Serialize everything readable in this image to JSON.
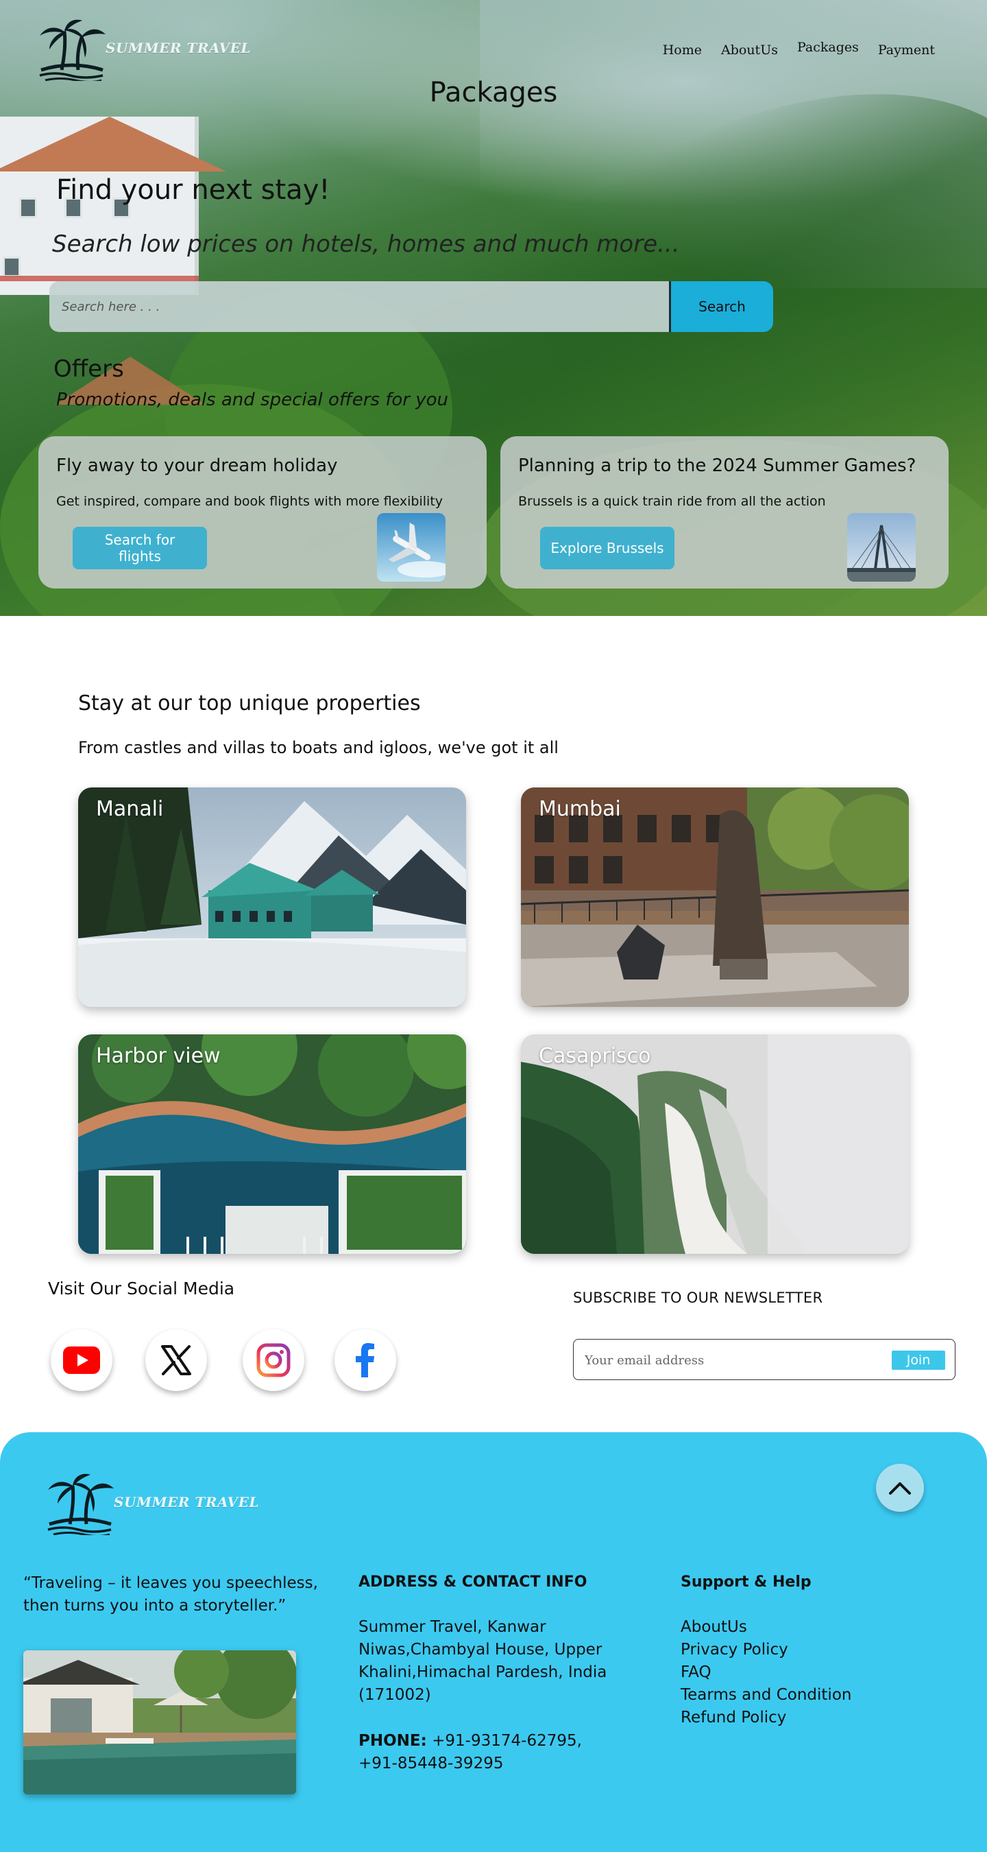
{
  "brand": {
    "name": "SUMMER TRAVEL"
  },
  "nav": {
    "items": [
      "Home",
      "AboutUs",
      "Packages",
      "Payment"
    ]
  },
  "page": {
    "title": "Packages"
  },
  "hero": {
    "title": "Find your next stay!",
    "subtitle": "Search low prices on hotels, homes and much more...",
    "search": {
      "placeholder": "Search here . . .",
      "button": "Search"
    }
  },
  "offers": {
    "title": "Offers",
    "subtitle": "Promotions, deals and special offers for you",
    "cards": [
      {
        "title": "Fly away to your dream holiday",
        "text": "Get inspired, compare and book flights with more flexibility",
        "button": "Search for flights",
        "image": "airplane-photo"
      },
      {
        "title": "Planning a trip to the 2024 Summer Games?",
        "text": "Brussels is a quick train ride from all the action",
        "button": "Explore Brussels",
        "image": "bridge-photo"
      }
    ]
  },
  "properties": {
    "title": "Stay at our top unique properties",
    "subtitle": "From castles and villas to boats and igloos, we've got it all",
    "items": [
      {
        "label": "Manali"
      },
      {
        "label": "Mumbai"
      },
      {
        "label": "Harbor view"
      },
      {
        "label": "Casaprisco"
      }
    ]
  },
  "social": {
    "title": "Visit Our Social Media",
    "icons": [
      "youtube-icon",
      "x-icon",
      "instagram-icon",
      "facebook-icon"
    ],
    "colors": {
      "youtube": "#ff0000",
      "x": "#111111",
      "facebook": "#1877f2"
    }
  },
  "newsletter": {
    "title": "SUBSCRIBE TO OUR NEWSLETTER",
    "placeholder": "Your email address",
    "button": "Join"
  },
  "footer": {
    "bg_color": "#3cc9f0",
    "quote": "“Traveling – it leaves you speechless, then turns you into a storyteller.”",
    "address_title": "ADDRESS & CONTACT INFO",
    "address": "Summer Travel, Kanwar Niwas,Chambyal House, Upper Khalini,Himachal Pardesh, India (171002)",
    "phone_label": "PHONE:",
    "phone": "+91-93174-62795, +91-85448-39295",
    "help_title": "Support & Help",
    "links": [
      "AboutUs",
      "Privacy Policy",
      "FAQ",
      "Tearms and Condition",
      "Refund Policy"
    ]
  }
}
